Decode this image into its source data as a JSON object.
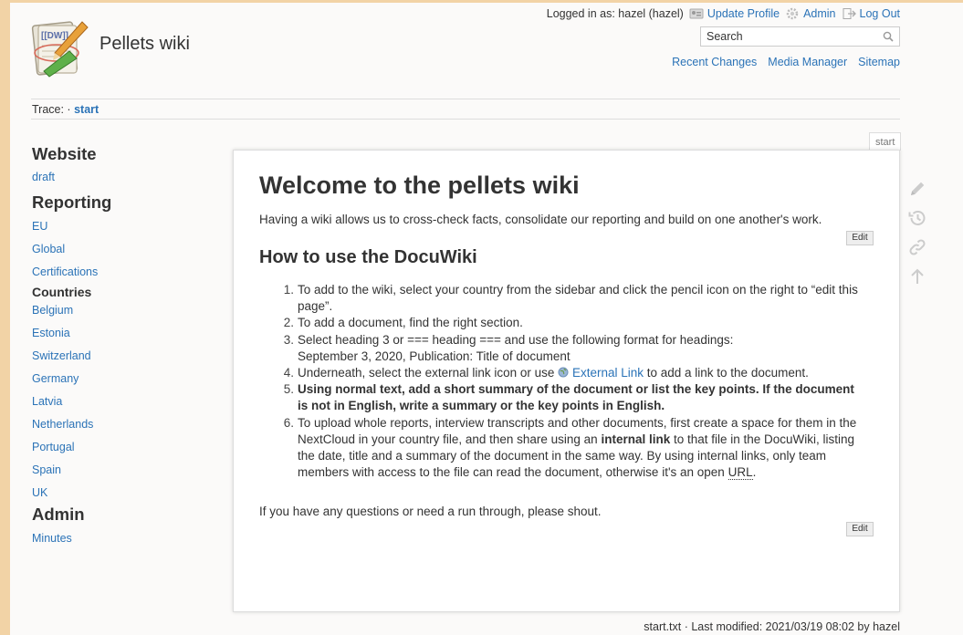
{
  "site": {
    "title": "Pellets wiki",
    "logo_text": "[[DW]]"
  },
  "user_bar": {
    "logged_in": "Logged in as: hazel (hazel)",
    "update_profile": "Update Profile",
    "admin": "Admin",
    "log_out": "Log Out"
  },
  "search": {
    "placeholder": "Search"
  },
  "tools": {
    "recent_changes": "Recent Changes",
    "media_manager": "Media Manager",
    "sitemap": "Sitemap"
  },
  "trace": {
    "label": "Trace: ·",
    "link": "start"
  },
  "sidebar": {
    "website_heading": "Website",
    "draft": "draft",
    "reporting_heading": "Reporting",
    "eu": "EU",
    "global": "Global",
    "certifications": "Certifications",
    "countries_heading": "Countries",
    "countries": [
      "Belgium",
      "Estonia",
      "Switzerland",
      "Germany",
      "Latvia",
      "Netherlands",
      "Portugal",
      "Spain",
      "UK"
    ],
    "admin_heading": "Admin",
    "minutes": "Minutes"
  },
  "page": {
    "tab": "start",
    "title": "Welcome to the pellets wiki",
    "intro": "Having a wiki allows us to cross-check facts, consolidate our reporting and build on one another's work.",
    "edit_label": "Edit",
    "section_title": "How to use the DocuWiki",
    "steps": {
      "n1": "1.",
      "s1_line1": "To add to the wiki, select your country from the sidebar and click the pencil icon on the right to “edit this",
      "s1_line2": "page”.",
      "n2": "2.",
      "s2": "To add a document, find the right section.",
      "n3": "3.",
      "s3_line1": "Select heading 3 or === heading === and use the following format for headings:",
      "s3_line2": "September 3, 2020, Publication: Title of document",
      "n4": "4.",
      "s4_pre": "Underneath, select the external link icon or use ",
      "s4_link": "External Link",
      "s4_post": " to add a link to the document.",
      "n5": "5.",
      "s5_line1": "Using normal text, add a short summary of the document or list the key points. If the document",
      "s5_line2": "is not in English, write a summary or the key points in English.",
      "n6": "6.",
      "s6_line1": "To upload whole reports, interview transcripts and other documents, first create a space for them in the",
      "s6_line2_pre": "NextCloud in your country file, and then share using an ",
      "s6_line2_bold": "internal link",
      "s6_line2_post": " to that file in the DocuWiki, listing",
      "s6_line3": "the date, title and a summary of the document in the same way. By using internal links, only team",
      "s6_line4_pre": "members with access to the file can read the document, otherwise it's an open ",
      "s6_line4_abbr": "URL",
      "s6_line4_post": "."
    },
    "closing": "If you have any questions or need a run through, please shout."
  },
  "footer": {
    "text": "start.txt · Last modified: 2021/03/19 08:02 by hazel"
  },
  "icons": {
    "profile": "id-card-icon",
    "admin": "gear-icon",
    "logout": "logout-icon",
    "search": "search-icon",
    "external": "globe-icon",
    "page_tools": [
      "pencil-icon",
      "history-icon",
      "link-icon",
      "arrow-up-icon"
    ]
  },
  "colors": {
    "link": "#2b73b7",
    "frame": "#f2d3a6"
  }
}
